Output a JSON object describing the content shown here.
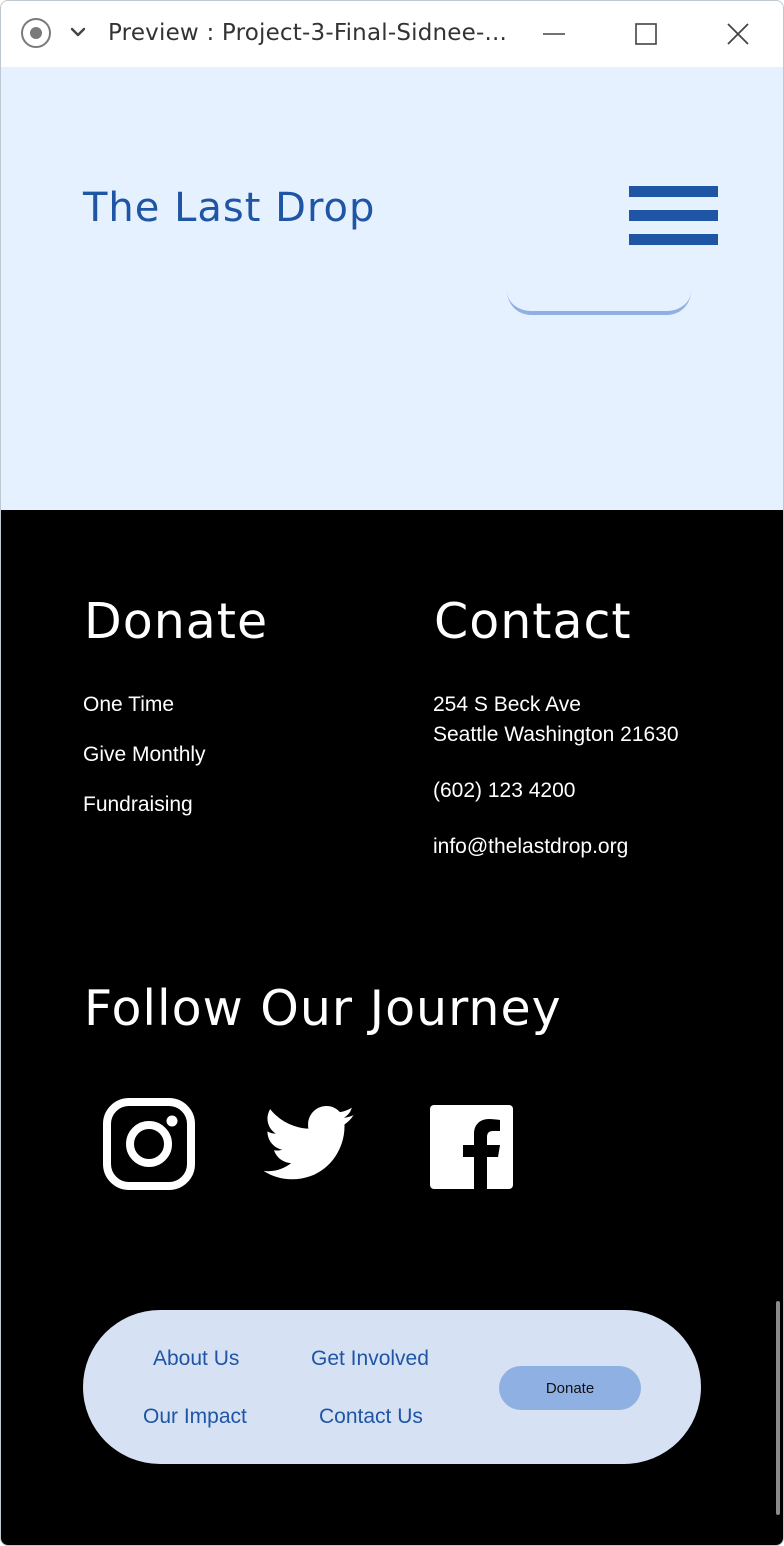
{
  "window": {
    "title": "Preview : Project-3-Final-Sidnee-..."
  },
  "header": {
    "brand": "The Last Drop"
  },
  "footer": {
    "donate": {
      "title": "Donate",
      "links": [
        "One Time",
        "Give Monthly",
        "Fundraising"
      ]
    },
    "contact": {
      "title": "Contact",
      "address_line1": "254 S Beck Ave",
      "address_line2": "Seattle Washington 21630",
      "phone": "(602) 123 4200",
      "email": "info@thelastdrop.org"
    },
    "follow": {
      "title": "Follow Our Journey",
      "icons": [
        "instagram-icon",
        "twitter-icon",
        "facebook-icon"
      ]
    },
    "nav": {
      "about": "About Us",
      "get_involved": "Get Involved",
      "impact": "Our Impact",
      "contact": "Contact Us",
      "donate_button": "Donate"
    }
  },
  "colors": {
    "brand_blue": "#1f55a5",
    "hero_bg": "#e6f1ff",
    "footer_bg": "#000000",
    "pill_bg": "#d6e2f3",
    "button_bg": "#8fb0e2"
  }
}
